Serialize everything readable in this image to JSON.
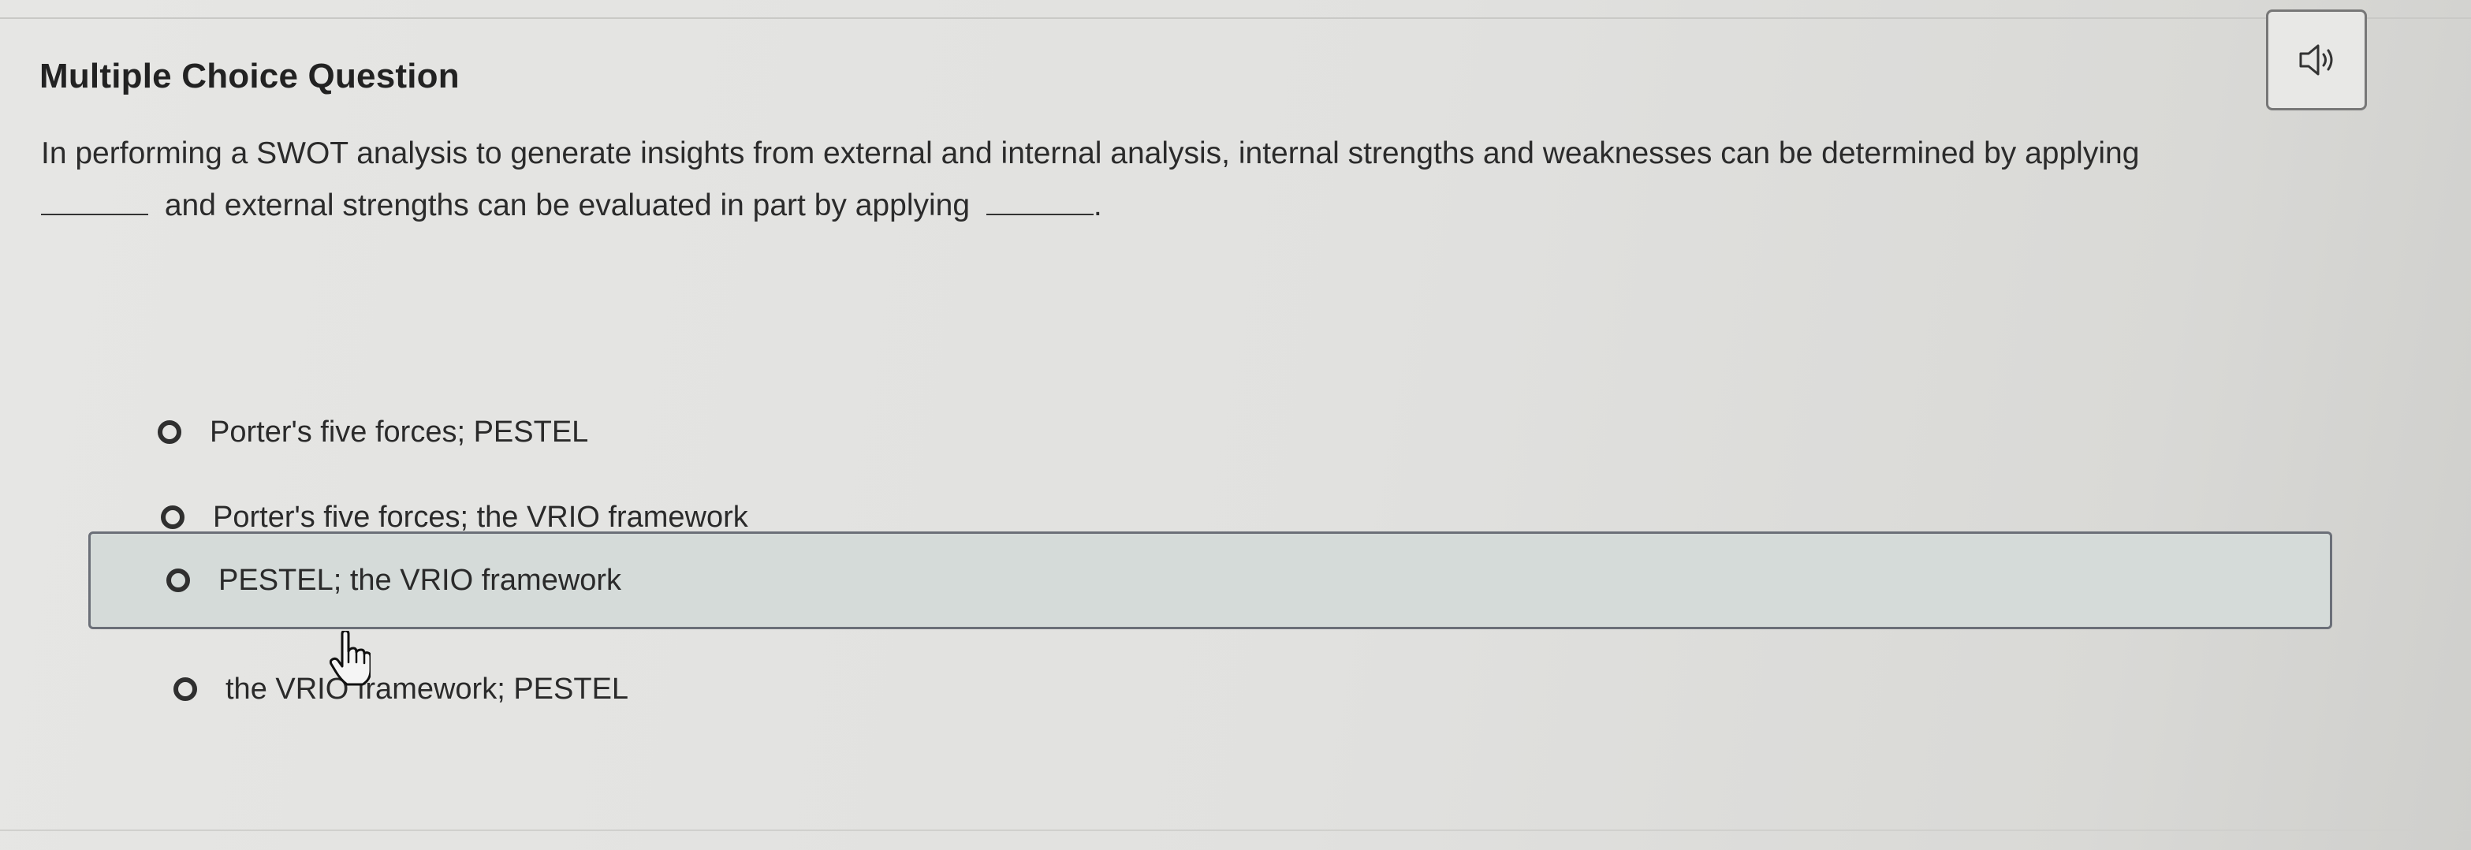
{
  "header": {
    "title": "Multiple Choice Question",
    "audio_icon": "speaker-icon"
  },
  "question": {
    "part1": "In performing a SWOT analysis to generate insights from external and internal analysis, internal strengths and weaknesses can be determined by applying",
    "part2": "and external strengths can be evaluated in part by applying",
    "part3": "."
  },
  "options": [
    {
      "label": "Porter's five forces; PESTEL",
      "selected": false,
      "hovered": false
    },
    {
      "label": "Porter's five forces; the VRIO framework",
      "selected": false,
      "hovered": false
    },
    {
      "label": "PESTEL; the VRIO framework",
      "selected": false,
      "hovered": true
    },
    {
      "label": "the VRIO framework; PESTEL",
      "selected": false,
      "hovered": false
    }
  ],
  "colors": {
    "hover_background": "#d5dbd9",
    "hover_border": "#6b6f78",
    "text": "#2a2a2a"
  },
  "cursor": "hand-pointer-icon"
}
